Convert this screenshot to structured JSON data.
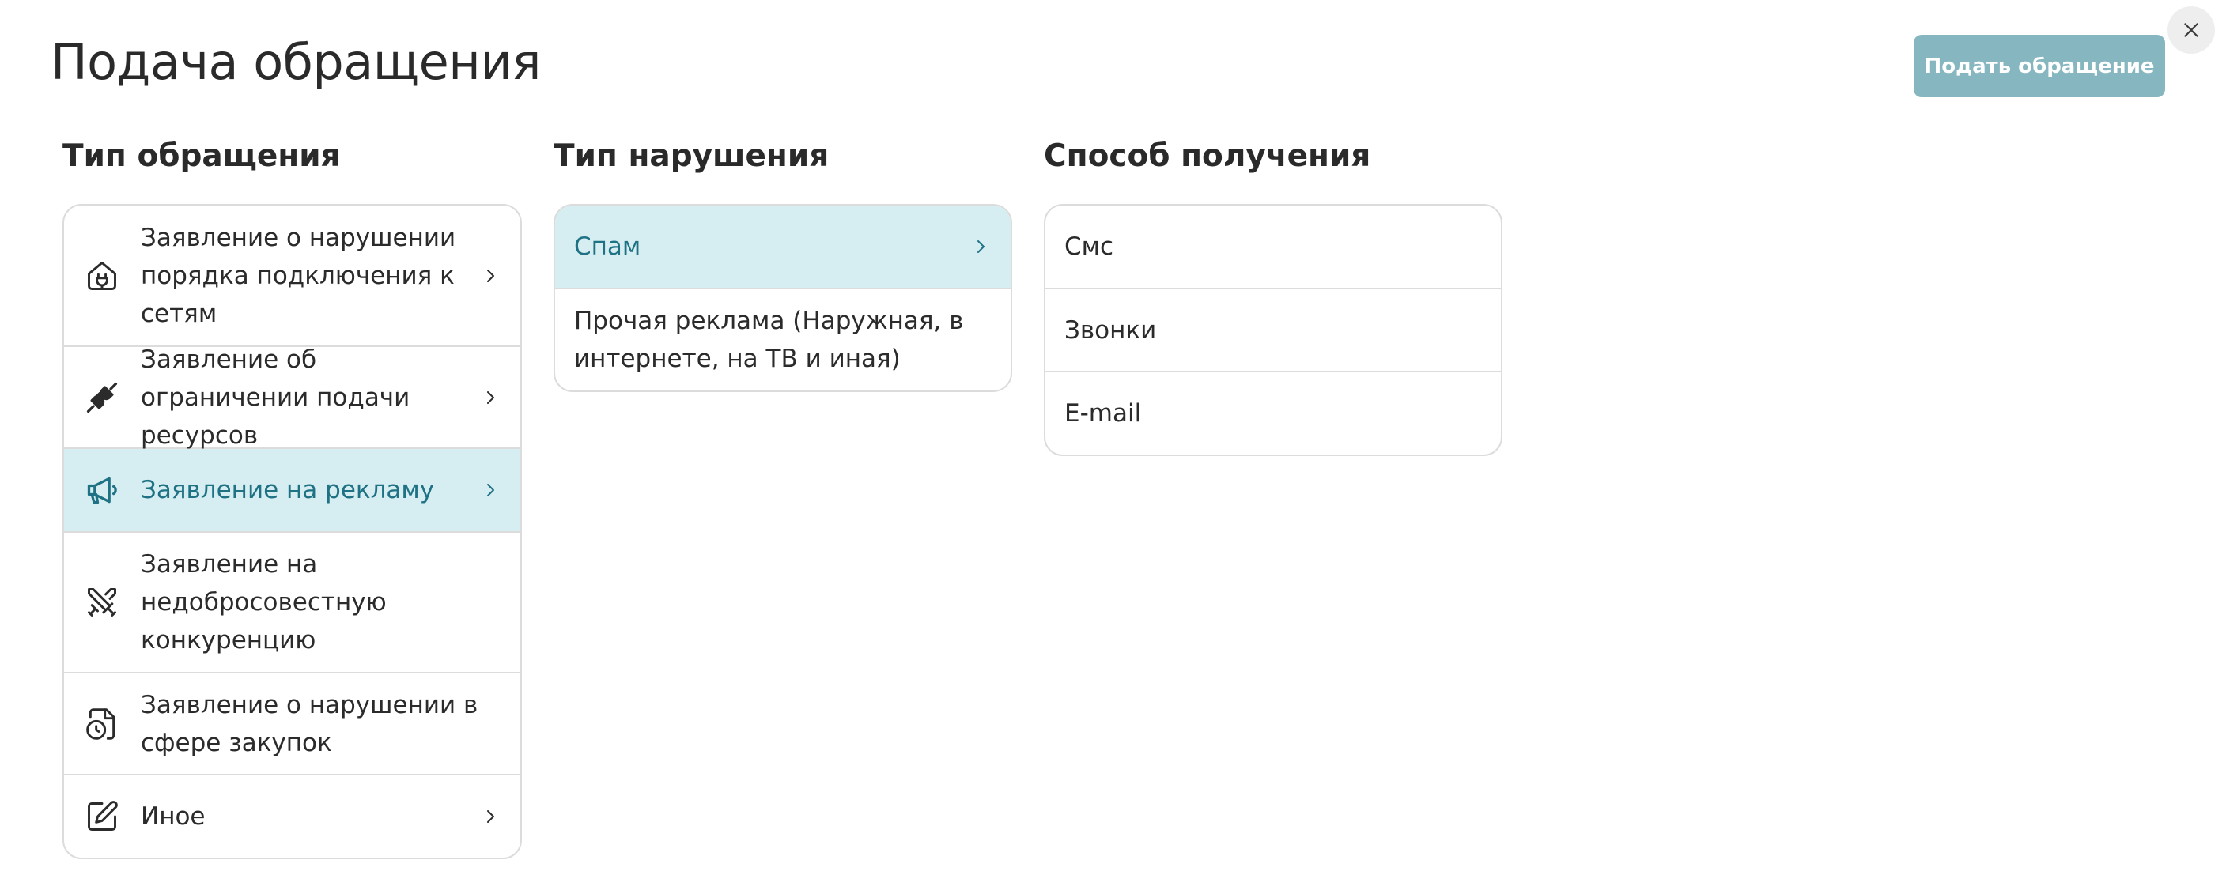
{
  "page": {
    "title": "Подача обращения",
    "submit_label": "Подать обращение"
  },
  "columns": {
    "request_type": {
      "title": "Тип обращения",
      "items": [
        {
          "label": "Заявление о нарушении порядка подключения к сетям",
          "icon": "plug-house-icon",
          "selected": false,
          "has_chevron": true
        },
        {
          "label": "Заявление об ограничении подачи ресурсов",
          "icon": "unplugged-icon",
          "selected": false,
          "has_chevron": true
        },
        {
          "label": "Заявление на рекламу",
          "icon": "megaphone-icon",
          "selected": true,
          "has_chevron": true
        },
        {
          "label": "Заявление на недобросовестную конкуренцию",
          "icon": "crossed-swords-icon",
          "selected": false,
          "has_chevron": false
        },
        {
          "label": "Заявление о нарушении в сфере закупок",
          "icon": "file-clock-icon",
          "selected": false,
          "has_chevron": false
        },
        {
          "label": "Иное",
          "icon": "edit-icon",
          "selected": false,
          "has_chevron": true
        }
      ]
    },
    "violation_type": {
      "title": "Тип нарушения",
      "items": [
        {
          "label": "Спам",
          "selected": true,
          "has_chevron": true
        },
        {
          "label": "Прочая реклама (Наружная, в интернете, на ТВ и иная)",
          "selected": false,
          "has_chevron": false
        }
      ]
    },
    "receipt_method": {
      "title": "Способ получения",
      "items": [
        {
          "label": "Смс"
        },
        {
          "label": "Звонки"
        },
        {
          "label": "E-mail"
        }
      ]
    }
  },
  "colors": {
    "accent": "#1e7284",
    "selected_bg": "#d6eef1",
    "button_bg": "#86b7c1",
    "border": "#dcdcdc"
  }
}
